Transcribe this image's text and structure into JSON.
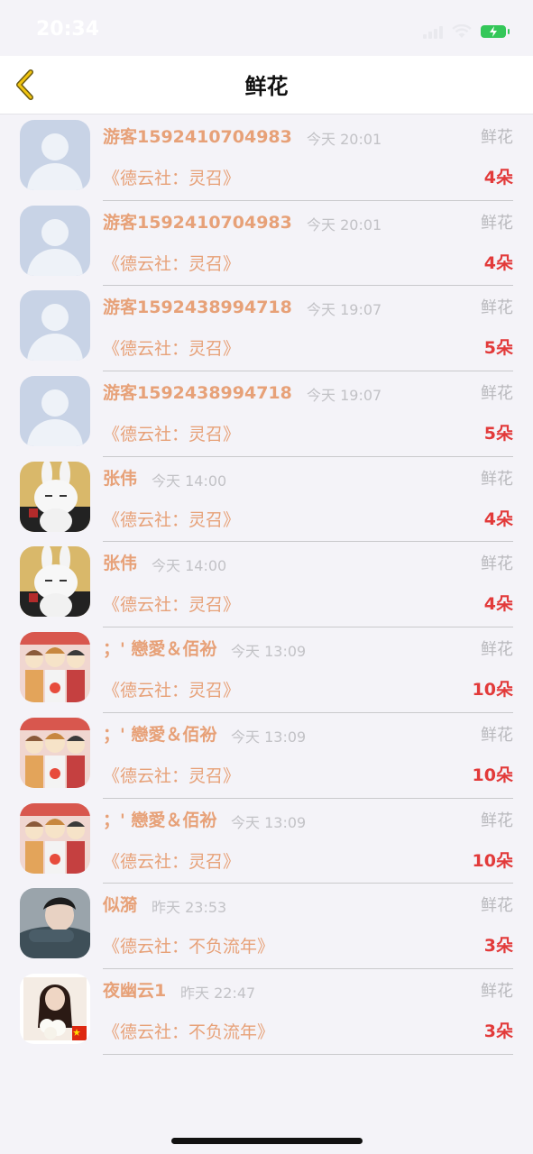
{
  "status_bar": {
    "time": "20:34"
  },
  "nav": {
    "title": "鲜花"
  },
  "items": [
    {
      "name": "游客1592410704983",
      "time": "今天 20:01",
      "type": "鲜花",
      "book": "《德云社：灵召》",
      "count": "4朵",
      "avatar": "default-avatar"
    },
    {
      "name": "游客1592410704983",
      "time": "今天 20:01",
      "type": "鲜花",
      "book": "《德云社：灵召》",
      "count": "4朵",
      "avatar": "default-avatar"
    },
    {
      "name": "游客1592438994718",
      "time": "今天 19:07",
      "type": "鲜花",
      "book": "《德云社：灵召》",
      "count": "5朵",
      "avatar": "default-avatar"
    },
    {
      "name": "游客1592438994718",
      "time": "今天 19:07",
      "type": "鲜花",
      "book": "《德云社：灵召》",
      "count": "5朵",
      "avatar": "default-avatar"
    },
    {
      "name": "张伟",
      "time": "今天 14:00",
      "type": "鲜花",
      "book": "《德云社：灵召》",
      "count": "4朵",
      "avatar": "rabbit-avatar"
    },
    {
      "name": "张伟",
      "time": "今天 14:00",
      "type": "鲜花",
      "book": "《德云社：灵召》",
      "count": "4朵",
      "avatar": "rabbit-avatar"
    },
    {
      "name": "；' 戀愛＆佰衯",
      "time": "今天 13:09",
      "type": "鲜花",
      "book": "《德云社：灵召》",
      "count": "10朵",
      "avatar": "anime-group-avatar"
    },
    {
      "name": "；' 戀愛＆佰衯",
      "time": "今天 13:09",
      "type": "鲜花",
      "book": "《德云社：灵召》",
      "count": "10朵",
      "avatar": "anime-group-avatar"
    },
    {
      "name": "；' 戀愛＆佰衯",
      "time": "今天 13:09",
      "type": "鲜花",
      "book": "《德云社：灵召》",
      "count": "10朵",
      "avatar": "anime-group-avatar"
    },
    {
      "name": "似漪",
      "time": "昨天 23:53",
      "type": "鲜花",
      "book": "《德云社：不负流年》",
      "count": "3朵",
      "avatar": "person-photo-avatar"
    },
    {
      "name": "夜幽云1",
      "time": "昨天 22:47",
      "type": "鲜花",
      "book": "《德云社：不负流年》",
      "count": "3朵",
      "avatar": "woman-flowers-avatar"
    }
  ]
}
